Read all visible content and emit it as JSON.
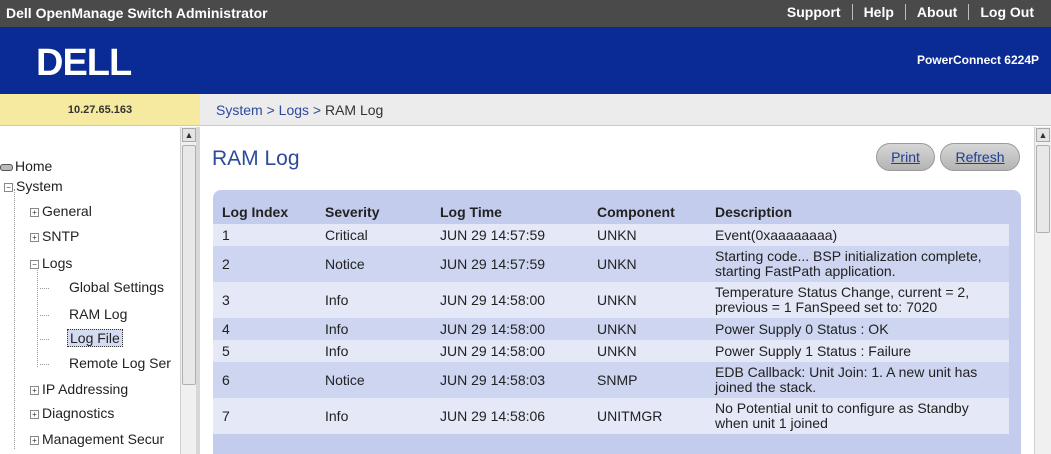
{
  "header": {
    "app_title": "Dell OpenManage Switch Administrator",
    "links": [
      "Support",
      "Help",
      "About",
      "Log Out"
    ]
  },
  "banner": {
    "logo_text": "DELL",
    "model": "PowerConnect 6224P"
  },
  "device": {
    "ip": "10.27.65.163"
  },
  "breadcrumb": {
    "items": [
      "System",
      "Logs",
      "RAM Log"
    ],
    "separator": ">"
  },
  "sidebar": {
    "items": [
      {
        "label": "Home"
      },
      {
        "label": "System",
        "toggle": "−"
      },
      {
        "label": "General",
        "toggle": "+"
      },
      {
        "label": "SNTP",
        "toggle": "+"
      },
      {
        "label": "Logs",
        "toggle": "−"
      },
      {
        "label": "Global Settings"
      },
      {
        "label": "RAM Log"
      },
      {
        "label": "Log File",
        "selected": true
      },
      {
        "label": "Remote Log Ser"
      },
      {
        "label": "IP Addressing",
        "toggle": "+"
      },
      {
        "label": "Diagnostics",
        "toggle": "+"
      },
      {
        "label": "Management Secur",
        "toggle": "+"
      }
    ]
  },
  "main": {
    "title": "RAM Log",
    "buttons": {
      "print": "Print",
      "refresh": "Refresh"
    },
    "columns": [
      "Log Index",
      "Severity",
      "Log Time",
      "Component",
      "Description"
    ],
    "rows": [
      [
        "1",
        "Critical",
        "JUN 29 14:57:59",
        "UNKN",
        "Event(0xaaaaaaaa)"
      ],
      [
        "2",
        "Notice",
        "JUN 29 14:57:59",
        "UNKN",
        "Starting code... BSP initialization complete, starting FastPath application."
      ],
      [
        "3",
        "Info",
        "JUN 29 14:58:00",
        "UNKN",
        "Temperature Status Change, current = 2, previous = 1 FanSpeed set to: 7020"
      ],
      [
        "4",
        "Info",
        "JUN 29 14:58:00",
        "UNKN",
        "Power Supply 0 Status : OK"
      ],
      [
        "5",
        "Info",
        "JUN 29 14:58:00",
        "UNKN",
        "Power Supply 1 Status : Failure"
      ],
      [
        "6",
        "Notice",
        "JUN 29 14:58:03",
        "SNMP",
        "EDB Callback: Unit Join: 1. A new unit has joined the stack."
      ],
      [
        "7",
        "Info",
        "JUN 29 14:58:06",
        "UNITMGR",
        "No Potential unit to configure as Standby when unit 1 joined"
      ]
    ]
  },
  "colors": {
    "topbar": "#4a4a4a",
    "banner": "#0a2a94",
    "ip_strip": "#f6eaa0",
    "link": "#2d4a9c",
    "panel": "#c3ccec",
    "row_light": "#e4e8f7",
    "row_dark": "#cdd5f0"
  }
}
